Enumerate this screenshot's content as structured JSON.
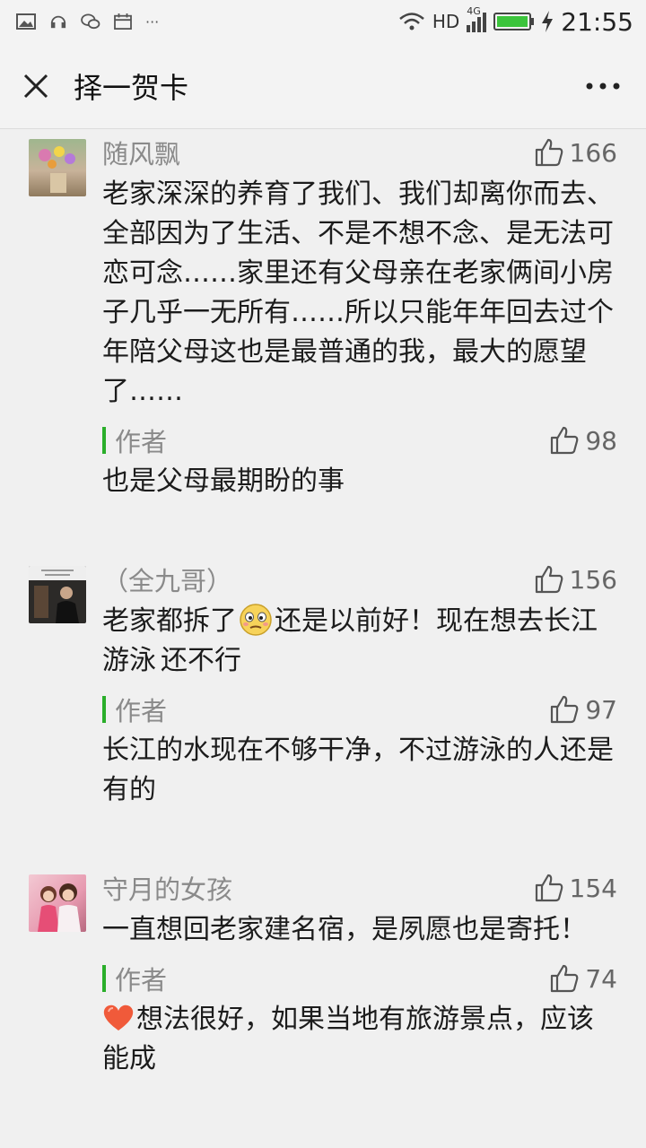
{
  "status_bar": {
    "time": "21:55",
    "network": "HD",
    "signal_label": "4G",
    "more": "···"
  },
  "header": {
    "title": "择一贺卡"
  },
  "comments": [
    {
      "name": "随风飘",
      "likes": "166",
      "text": "老家深深的养育了我们、我们却离你而去、全部因为了生活、不是不想不念、是无法可恋可念……家里还有父母亲在老家俩间小房子几乎一无所有……所以只能年年回去过个年陪父母这也是最普通的我，最大的愿望了……",
      "reply": {
        "label": "作者",
        "likes": "98",
        "text": "也是父母最期盼的事"
      }
    },
    {
      "name": "（全九哥）",
      "likes": "156",
      "text_before": "老家都拆了",
      "text_after": "还是以前好！现在想去长江游泳 还不行",
      "reply": {
        "label": "作者",
        "likes": "97",
        "text": "长江的水现在不够干净，不过游泳的人还是有的"
      }
    },
    {
      "name": "守月的女孩",
      "likes": "154",
      "text": "一直想回老家建名宿，是夙愿也是寄托！",
      "reply": {
        "label": "作者",
        "likes": "74",
        "text": "想法很好，如果当地有旅游景点，应该能成"
      }
    }
  ],
  "colors": {
    "accent_green": "#2aae2a",
    "background": "#f0f0f0",
    "battery_green": "#3cc43c"
  }
}
